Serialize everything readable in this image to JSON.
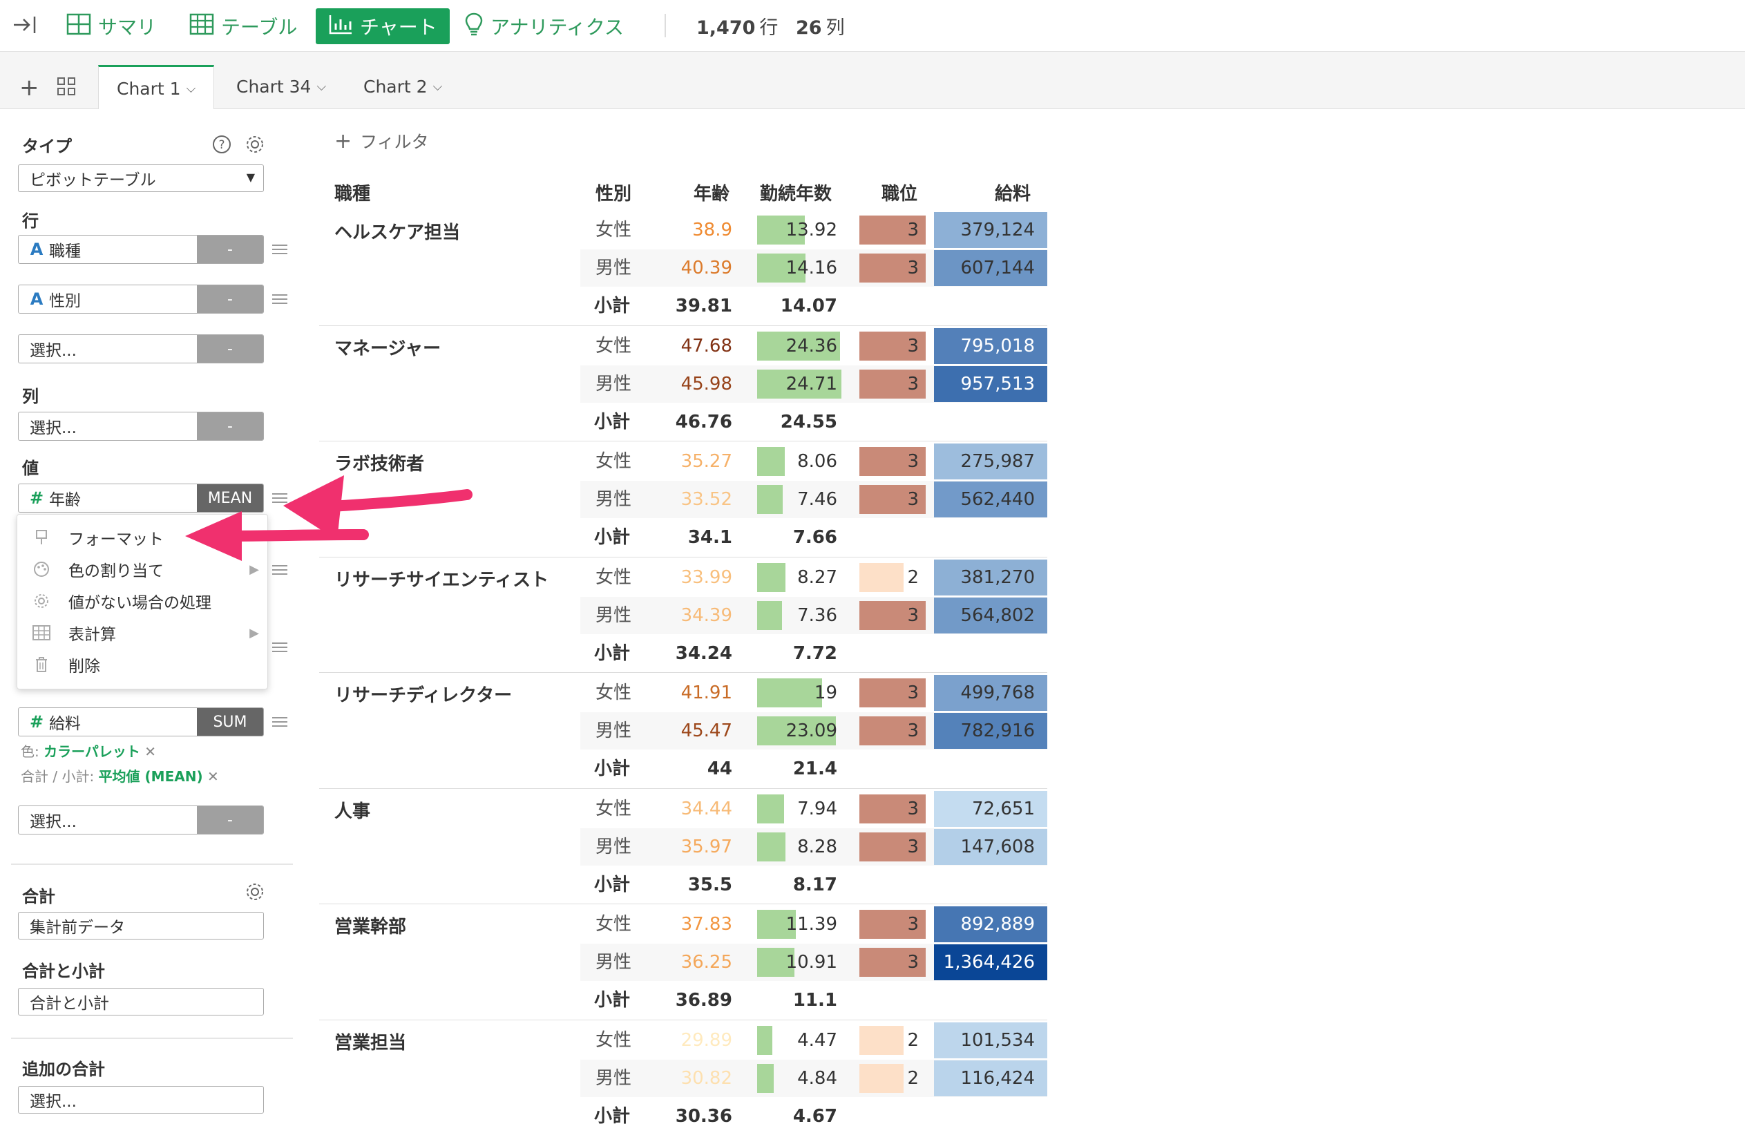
{
  "toolbar": {
    "items": [
      {
        "label": "サマリ",
        "icon": "summary-icon"
      },
      {
        "label": "テーブル",
        "icon": "table-icon"
      },
      {
        "label": "チャート",
        "icon": "chart-icon",
        "active": true
      },
      {
        "label": "アナリティクス",
        "icon": "lightbulb-icon"
      }
    ],
    "rows_count": "1,470",
    "rows_unit": "行",
    "cols_count": "26",
    "cols_unit": "列"
  },
  "tabs": [
    {
      "label": "Chart 1",
      "active": true
    },
    {
      "label": "Chart 34"
    },
    {
      "label": "Chart 2"
    }
  ],
  "panel": {
    "type_title": "タイプ",
    "type_value": "ピボットテーブル",
    "rows_title": "行",
    "row_fields": [
      {
        "type": "A",
        "name": "職種",
        "button": "-"
      },
      {
        "type": "A",
        "name": "性別",
        "button": "-"
      },
      {
        "type": "",
        "name": "選択...",
        "button": "-"
      }
    ],
    "cols_title": "列",
    "col_field": {
      "name": "選択...",
      "button": "-"
    },
    "values_title": "値",
    "value_fields": [
      {
        "type": "#",
        "name": "年齢",
        "button": "MEAN"
      },
      {
        "type": "#",
        "name": "給料",
        "button": "SUM"
      }
    ],
    "color_label": "色:",
    "color_value": "カラーパレット",
    "total_label": "合計 / 小計:",
    "total_value": "平均値 (MEAN)",
    "value_select": {
      "name": "選択...",
      "button": "-"
    },
    "sum_title": "合計",
    "sum_value": "集計前データ",
    "subtotal_title": "合計と小計",
    "subtotal_value": "合計と小計",
    "extra_title": "追加の合計",
    "extra_value": "選択..."
  },
  "menu": [
    {
      "label": "フォーマット",
      "icon": "format-icon",
      "submenu": false
    },
    {
      "label": "色の割り当て",
      "icon": "palette-icon",
      "submenu": true
    },
    {
      "label": "値がない場合の処理",
      "icon": "gear-icon",
      "submenu": false
    },
    {
      "label": "表計算",
      "icon": "table-icon",
      "submenu": true
    },
    {
      "label": "削除",
      "icon": "trash-icon",
      "submenu": false
    }
  ],
  "filter_label": "フィルタ",
  "table": {
    "headers": [
      "職種",
      "性別",
      "年齢",
      "勤続年数",
      "職位",
      "給料"
    ],
    "subtotal_label": "小計",
    "groups": [
      {
        "name": "ヘルスケア担当",
        "rows": [
          {
            "sex": "女性",
            "age": "38.9",
            "tenure": "13.92",
            "pos": "3",
            "salary": "379,124"
          },
          {
            "sex": "男性",
            "age": "40.39",
            "tenure": "14.16",
            "pos": "3",
            "salary": "607,144"
          }
        ],
        "sub_age": "39.81",
        "sub_tenure": "14.07"
      },
      {
        "name": "マネージャー",
        "rows": [
          {
            "sex": "女性",
            "age": "47.68",
            "tenure": "24.36",
            "pos": "3",
            "salary": "795,018"
          },
          {
            "sex": "男性",
            "age": "45.98",
            "tenure": "24.71",
            "pos": "3",
            "salary": "957,513"
          }
        ],
        "sub_age": "46.76",
        "sub_tenure": "24.55"
      },
      {
        "name": "ラボ技術者",
        "rows": [
          {
            "sex": "女性",
            "age": "35.27",
            "tenure": "8.06",
            "pos": "3",
            "salary": "275,987"
          },
          {
            "sex": "男性",
            "age": "33.52",
            "tenure": "7.46",
            "pos": "3",
            "salary": "562,440"
          }
        ],
        "sub_age": "34.1",
        "sub_tenure": "7.66"
      },
      {
        "name": "リサーチサイエンティスト",
        "rows": [
          {
            "sex": "女性",
            "age": "33.99",
            "tenure": "8.27",
            "pos": "2",
            "salary": "381,270"
          },
          {
            "sex": "男性",
            "age": "34.39",
            "tenure": "7.36",
            "pos": "3",
            "salary": "564,802"
          }
        ],
        "sub_age": "34.24",
        "sub_tenure": "7.72"
      },
      {
        "name": "リサーチディレクター",
        "rows": [
          {
            "sex": "女性",
            "age": "41.91",
            "tenure": "19",
            "pos": "3",
            "salary": "499,768"
          },
          {
            "sex": "男性",
            "age": "45.47",
            "tenure": "23.09",
            "pos": "3",
            "salary": "782,916"
          }
        ],
        "sub_age": "44",
        "sub_tenure": "21.4"
      },
      {
        "name": "人事",
        "rows": [
          {
            "sex": "女性",
            "age": "34.44",
            "tenure": "7.94",
            "pos": "3",
            "salary": "72,651"
          },
          {
            "sex": "男性",
            "age": "35.97",
            "tenure": "8.28",
            "pos": "3",
            "salary": "147,608"
          }
        ],
        "sub_age": "35.5",
        "sub_tenure": "8.17"
      },
      {
        "name": "営業幹部",
        "rows": [
          {
            "sex": "女性",
            "age": "37.83",
            "tenure": "11.39",
            "pos": "3",
            "salary": "892,889"
          },
          {
            "sex": "男性",
            "age": "36.25",
            "tenure": "10.91",
            "pos": "3",
            "salary": "1,364,426"
          }
        ],
        "sub_age": "36.89",
        "sub_tenure": "11.1"
      },
      {
        "name": "営業担当",
        "rows": [
          {
            "sex": "女性",
            "age": "29.89",
            "tenure": "4.47",
            "pos": "2",
            "salary": "101,534"
          },
          {
            "sex": "男性",
            "age": "30.82",
            "tenure": "4.84",
            "pos": "2",
            "salary": "116,424"
          }
        ],
        "sub_age": "30.36",
        "sub_tenure": "4.67"
      }
    ]
  },
  "colors": {
    "accent": "#1aa05a",
    "arrow": "#f0306e",
    "tenure_bar": "#a8d69a",
    "pos3": "#c98a78",
    "pos2": "#fde0c8"
  }
}
